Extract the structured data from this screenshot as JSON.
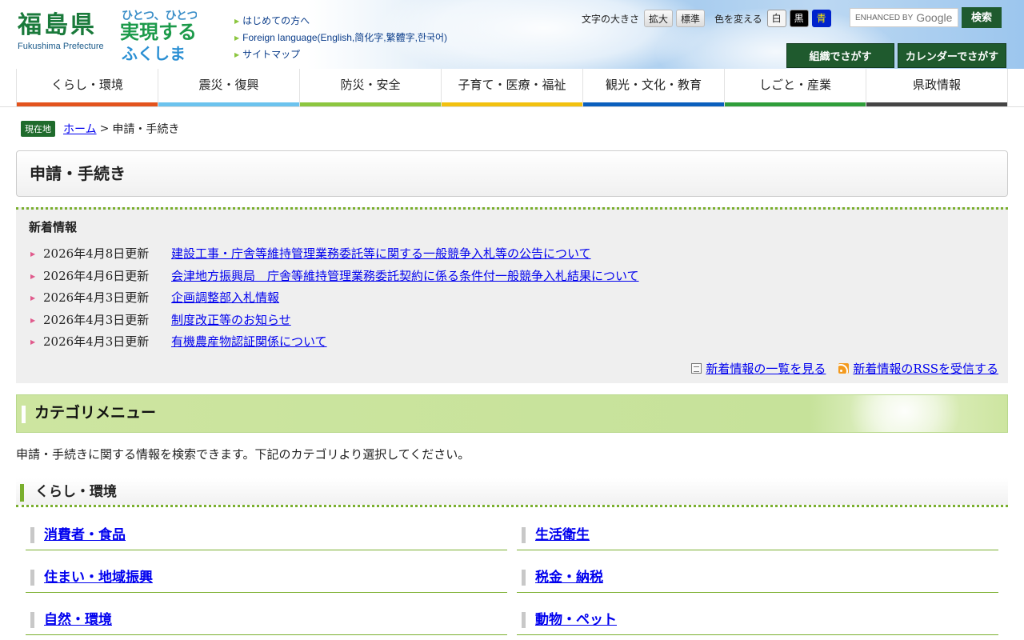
{
  "header": {
    "logo_jp": "福島県",
    "logo_en": "Fukushima Prefecture",
    "slogan_line1": "ひとつ、ひとつ、",
    "slogan_line2": "実現する",
    "slogan_line3": "ふくしま",
    "util_links": [
      "はじめての方へ",
      "Foreign language(English,简化字,繁體字,한국어)",
      "サイトマップ"
    ],
    "font_size_label": "文字の大きさ",
    "font_enlarge": "拡大",
    "font_standard": "標準",
    "color_label": "色を変える",
    "color_white": "白",
    "color_black": "黒",
    "color_blue": "青",
    "search_enhanced": "ENHANCED BY",
    "search_google": "Google",
    "search_button": "検索",
    "org_search": "組織でさがす",
    "calendar_search": "カレンダーでさがす"
  },
  "nav": [
    {
      "label": "くらし・環境",
      "color": "#e3531d"
    },
    {
      "label": "震災・復興",
      "color": "#6cc3ee"
    },
    {
      "label": "防災・安全",
      "color": "#8cc63f"
    },
    {
      "label": "子育て・医療・福祉",
      "color": "#f2c10f"
    },
    {
      "label": "観光・文化・教育",
      "color": "#0b5fbd"
    },
    {
      "label": "しごと・産業",
      "color": "#2f9e3a"
    },
    {
      "label": "県政情報",
      "color": "#444444"
    }
  ],
  "breadcrumb": {
    "here": "現在地",
    "home": "ホーム",
    "separator": ">",
    "current": "申請・手続き"
  },
  "page_title": "申請・手続き",
  "news": {
    "heading": "新着情報",
    "items": [
      {
        "date": "2026年4月8日更新",
        "title": "建設工事・庁舎等維持管理業務委託等に関する一般競争入札等の公告について"
      },
      {
        "date": "2026年4月6日更新",
        "title": "会津地方振興局　庁舎等維持管理業務委託契約に係る条件付一般競争入札結果について"
      },
      {
        "date": "2026年4月3日更新",
        "title": "企画調整部入札情報"
      },
      {
        "date": "2026年4月3日更新",
        "title": "制度改正等のお知らせ"
      },
      {
        "date": "2026年4月3日更新",
        "title": "有機農産物認証関係について"
      }
    ],
    "list_link": "新着情報の一覧を見る",
    "rss_link": "新着情報のRSSを受信する"
  },
  "category_menu": {
    "heading": "カテゴリメニュー",
    "intro": "申請・手続きに関する情報を検索できます。下記のカテゴリより選択してください。",
    "section_title": "くらし・環境",
    "links": [
      "消費者・食品",
      "生活衛生",
      "住まい・地域振興",
      "税金・納税",
      "自然・環境",
      "動物・ペット"
    ]
  }
}
